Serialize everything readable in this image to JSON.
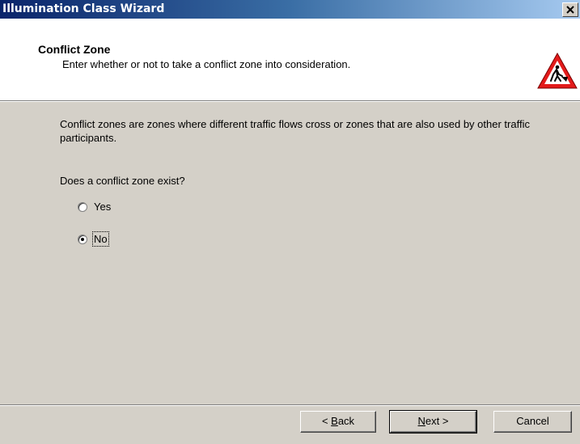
{
  "window": {
    "title": "Illumination Class Wizard",
    "close_glyph": "×"
  },
  "header": {
    "title": "Conflict Zone",
    "subtitle": "Enter whether or not to take a conflict zone into consideration.",
    "icon": "road-works-warning-icon"
  },
  "body": {
    "description": "Conflict zones are zones where different traffic flows cross or zones that are also used by other traffic participants.",
    "question": "Does a conflict zone exist?",
    "options": [
      {
        "label": "Yes",
        "selected": false
      },
      {
        "label": "No",
        "selected": true
      }
    ]
  },
  "buttons": {
    "back_mnemonic": "B",
    "back_rest": "ack",
    "back_prefix": "< ",
    "next_mnemonic": "N",
    "next_rest": "ext >",
    "cancel": "Cancel"
  },
  "colors": {
    "titlebar_start": "#0a246a",
    "titlebar_end": "#a6caf0",
    "dialog_bg": "#d4d0c8",
    "warning_red": "#e31b1b"
  }
}
